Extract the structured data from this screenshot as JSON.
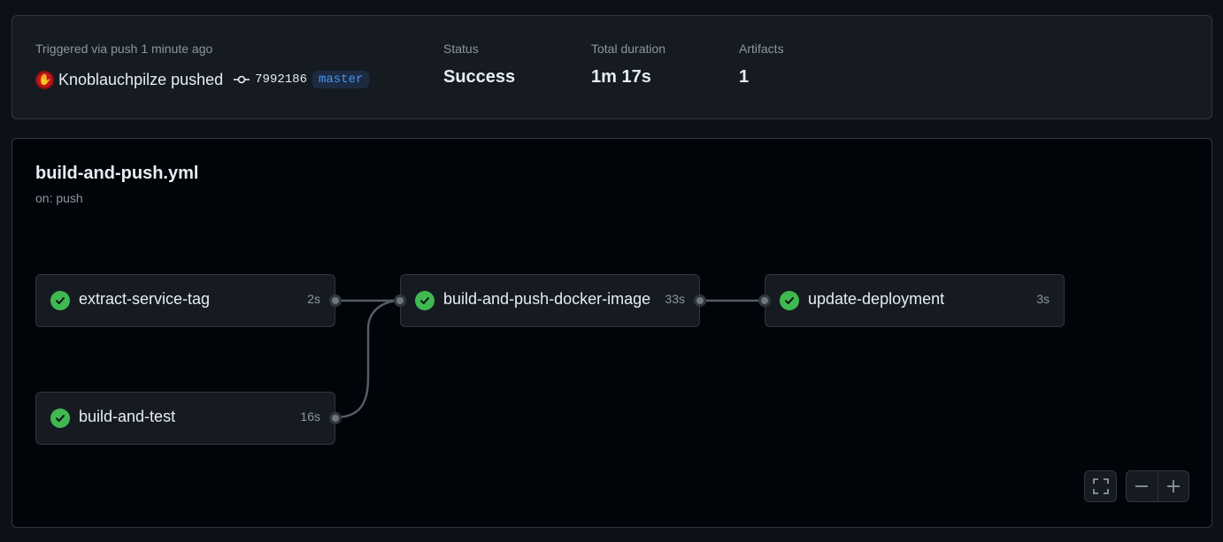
{
  "run": {
    "trigger_text": "Triggered via push 1 minute ago",
    "actor": "Knoblauchpilze pushed",
    "avatar_icon": "hand-stop-icon",
    "commit_sha": "7992186",
    "branch": "master"
  },
  "stats": {
    "status_label": "Status",
    "status_value": "Success",
    "duration_label": "Total duration",
    "duration_value": "1m 17s",
    "artifacts_label": "Artifacts",
    "artifacts_value": "1"
  },
  "workflow": {
    "name": "build-and-push.yml",
    "trigger": "on: push"
  },
  "jobs": [
    {
      "name": "extract-service-tag",
      "duration": "2s",
      "status": "success"
    },
    {
      "name": "build-and-test",
      "duration": "16s",
      "status": "success"
    },
    {
      "name": "build-and-push-docker-image",
      "duration": "33s",
      "status": "success"
    },
    {
      "name": "update-deployment",
      "duration": "3s",
      "status": "success"
    }
  ],
  "colors": {
    "success": "#3fb950",
    "branch_text": "#4493f8",
    "branch_bg": "#1c2b41"
  },
  "controls": {
    "fullscreen_icon": "fullscreen-icon",
    "zoom_out_icon": "minus-icon",
    "zoom_in_icon": "plus-icon"
  }
}
